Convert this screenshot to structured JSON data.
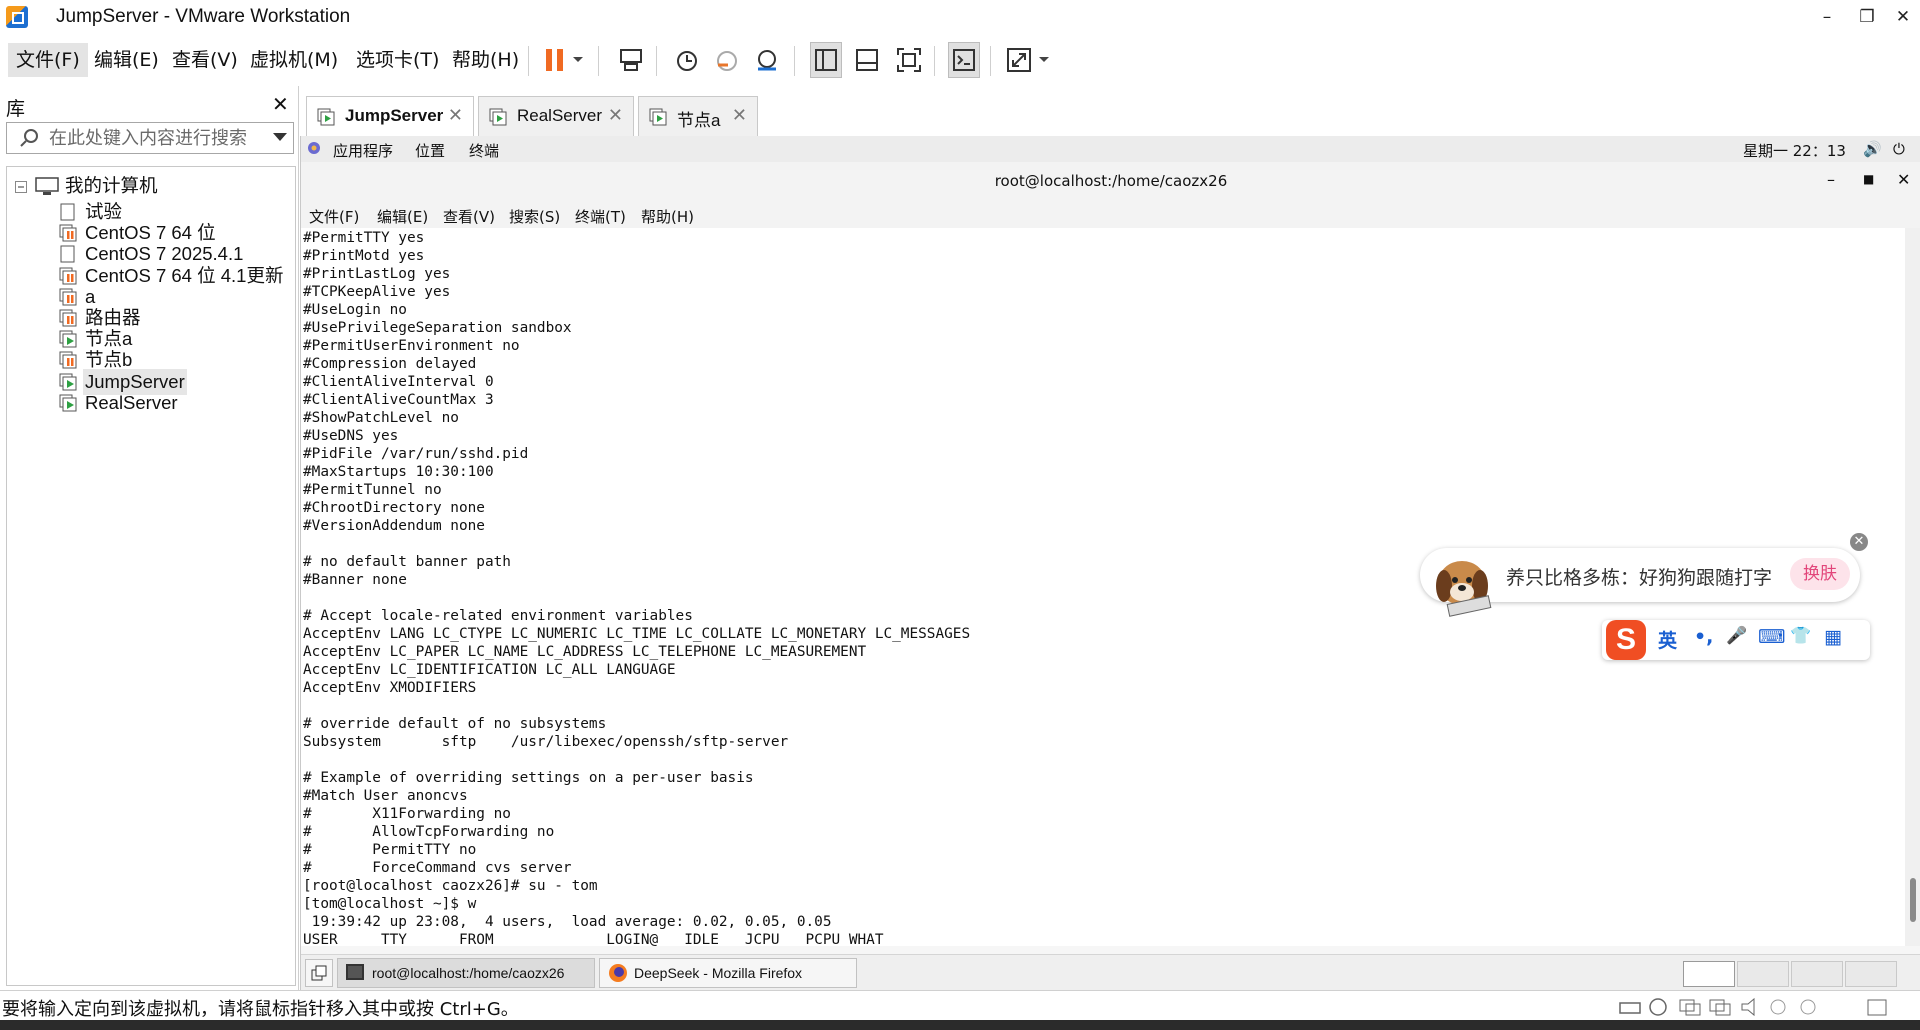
{
  "window": {
    "title": "JumpServer - VMware Workstation",
    "controls": [
      "–",
      "❐",
      "✕"
    ]
  },
  "menubar": {
    "items": [
      "文件(F)",
      "编辑(E)",
      "查看(V)",
      "虚拟机(M)",
      "选项卡(T)",
      "帮助(H)"
    ],
    "pause_color": "#f06a22"
  },
  "library": {
    "title": "库",
    "close": "✕",
    "search_placeholder": "在此处键入内容进行搜索",
    "root": "我的计算机",
    "items": [
      {
        "label": "试验",
        "state": "plain"
      },
      {
        "label": "CentOS 7 64 位",
        "state": "paused"
      },
      {
        "label": "CentOS 7 2025.4.1",
        "state": "plain"
      },
      {
        "label": "CentOS 7 64 位 4.1更新",
        "state": "paused"
      },
      {
        "label": "a",
        "state": "paused"
      },
      {
        "label": "路由器",
        "state": "paused"
      },
      {
        "label": "节点a",
        "state": "running"
      },
      {
        "label": "节点b",
        "state": "paused"
      },
      {
        "label": "JumpServer",
        "state": "running",
        "selected": true
      },
      {
        "label": "RealServer",
        "state": "running"
      }
    ]
  },
  "tabs": [
    {
      "label": "JumpServer",
      "active": true
    },
    {
      "label": "RealServer",
      "active": false
    },
    {
      "label": "节点a",
      "active": false
    }
  ],
  "guest": {
    "topbar": {
      "applications": "应用程序",
      "places": "位置",
      "terminal": "终端",
      "clock": "星期一 22：13"
    },
    "terminal_title": "root@localhost:/home/caozx26",
    "terminal_menu": [
      "文件(F)",
      "编辑(E)",
      "查看(V)",
      "搜索(S)",
      "终端(T)",
      "帮助(H)"
    ],
    "terminal_lines": [
      "#PermitTTY yes",
      "#PrintMotd yes",
      "#PrintLastLog yes",
      "#TCPKeepAlive yes",
      "#UseLogin no",
      "#UsePrivilegeSeparation sandbox",
      "#PermitUserEnvironment no",
      "#Compression delayed",
      "#ClientAliveInterval 0",
      "#ClientAliveCountMax 3",
      "#ShowPatchLevel no",
      "#UseDNS yes",
      "#PidFile /var/run/sshd.pid",
      "#MaxStartups 10:30:100",
      "#PermitTunnel no",
      "#ChrootDirectory none",
      "#VersionAddendum none",
      "",
      "# no default banner path",
      "#Banner none",
      "",
      "# Accept locale-related environment variables",
      "AcceptEnv LANG LC_CTYPE LC_NUMERIC LC_TIME LC_COLLATE LC_MONETARY LC_MESSAGES",
      "AcceptEnv LC_PAPER LC_NAME LC_ADDRESS LC_TELEPHONE LC_MEASUREMENT",
      "AcceptEnv LC_IDENTIFICATION LC_ALL LANGUAGE",
      "AcceptEnv XMODIFIERS",
      "",
      "# override default of no subsystems",
      "Subsystem       sftp    /usr/libexec/openssh/sftp-server",
      "",
      "# Example of overriding settings on a per-user basis",
      "#Match User anoncvs",
      "#       X11Forwarding no",
      "#       AllowTcpForwarding no",
      "#       PermitTTY no",
      "#       ForceCommand cvs server",
      "[root@localhost caozx26]# su - tom",
      "[tom@localhost ~]$ w",
      " 19:39:42 up 23:08,  4 users,  load average: 0.02, 0.05, 0.05",
      "USER     TTY      FROM             LOGIN@   IDLE   JCPU   PCPU WHAT"
    ],
    "taskbar": [
      {
        "label": "root@localhost:/home/caozx26"
      },
      {
        "label": "DeepSeek - Mozilla Firefox"
      }
    ]
  },
  "ime": {
    "toast_message": "养只比格多栋：好狗狗跟随打字",
    "toast_button": "换肤",
    "logo": "S",
    "bar_items": [
      "英",
      "•,",
      "🎤",
      "⌨",
      "👕",
      "▦"
    ],
    "close": "✕"
  },
  "statusbar": {
    "text": "要将输入定向到该虚拟机，请将鼠标指针移入其中或按 Ctrl+G。"
  }
}
